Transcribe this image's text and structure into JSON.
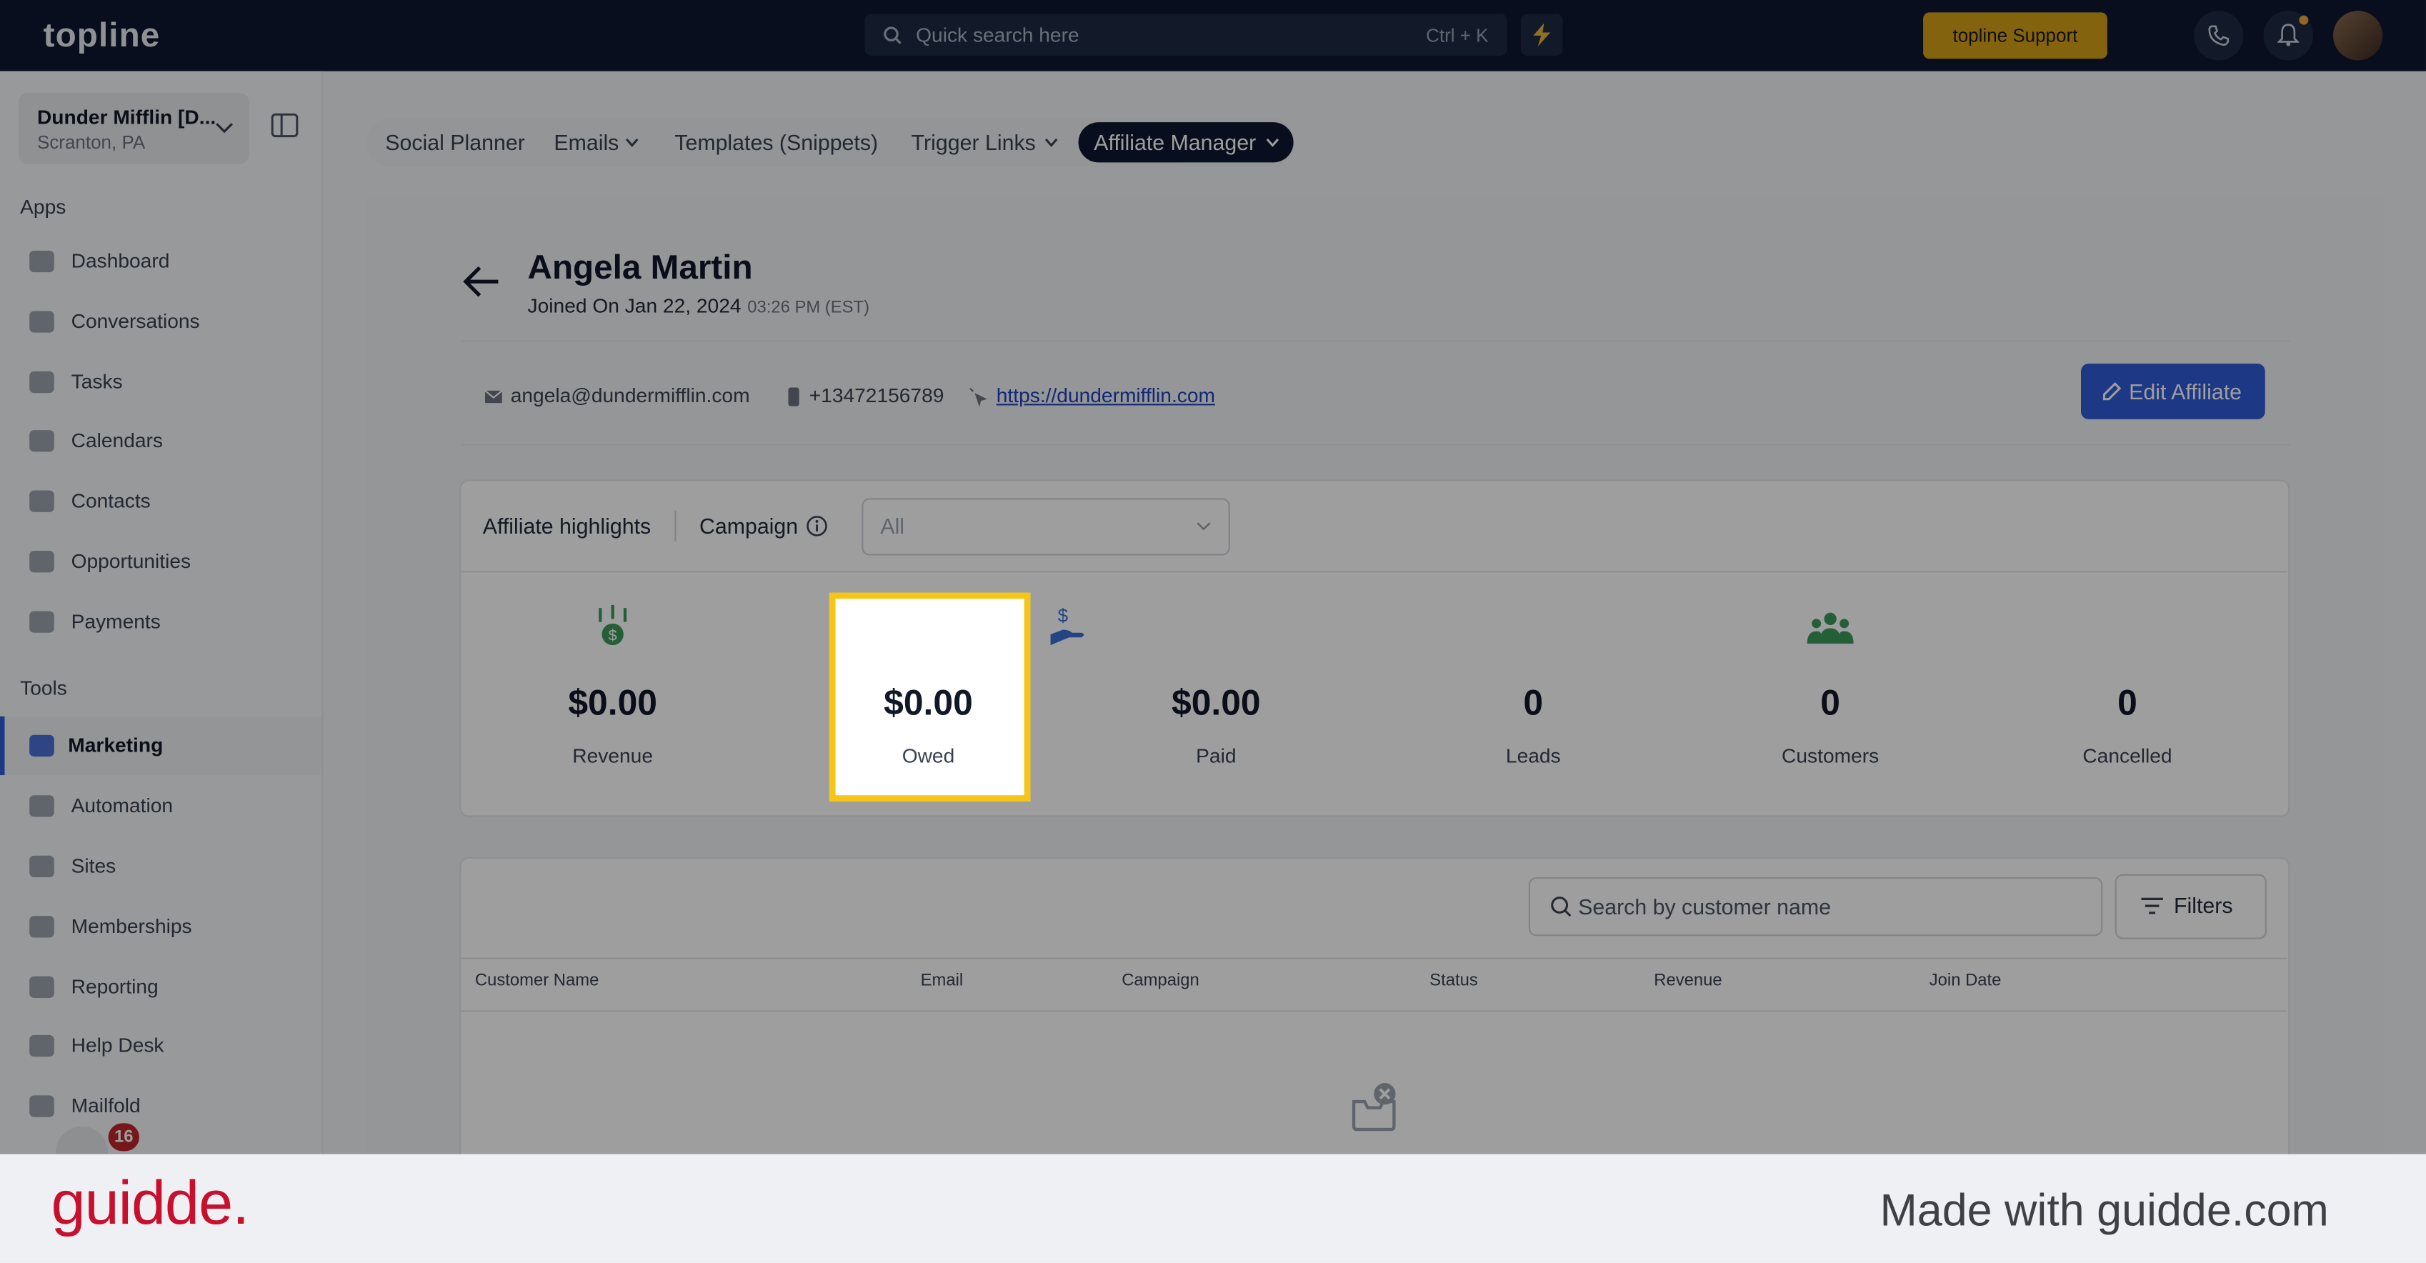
{
  "topbar": {
    "logo": "topline",
    "search_placeholder": "Quick search here",
    "shortcut": "Ctrl + K",
    "support_label": "topline Support"
  },
  "sidebar": {
    "account_name": "Dunder Mifflin [D...",
    "account_location": "Scranton, PA",
    "apps_heading": "Apps",
    "apps": [
      {
        "label": "Dashboard",
        "icon": "dashboard-icon"
      },
      {
        "label": "Conversations",
        "icon": "chat-icon"
      },
      {
        "label": "Tasks",
        "icon": "tasks-icon"
      },
      {
        "label": "Calendars",
        "icon": "calendar-icon"
      },
      {
        "label": "Contacts",
        "icon": "person-icon"
      },
      {
        "label": "Opportunities",
        "icon": "target-icon"
      },
      {
        "label": "Payments",
        "icon": "card-icon"
      }
    ],
    "tools_heading": "Tools",
    "tools": [
      {
        "label": "Marketing",
        "icon": "megaphone-icon"
      },
      {
        "label": "Automation",
        "icon": "gears-icon"
      },
      {
        "label": "Sites",
        "icon": "globe-icon"
      },
      {
        "label": "Memberships",
        "icon": "group-icon"
      },
      {
        "label": "Reporting",
        "icon": "pie-icon"
      },
      {
        "label": "Help Desk",
        "icon": "help-icon"
      },
      {
        "label": "Mailfold",
        "icon": "mail-icon"
      }
    ],
    "badge_count": "16"
  },
  "tabs": [
    {
      "label": "Social Planner"
    },
    {
      "label": "Emails"
    },
    {
      "label": "Templates (Snippets)"
    },
    {
      "label": "Trigger Links"
    },
    {
      "label": "Affiliate Manager"
    }
  ],
  "affiliate": {
    "name": "Angela Martin",
    "joined": "Joined On Jan 22, 2024",
    "joined_time": "03:26 PM (EST)",
    "email": "angela@dundermifflin.com",
    "phone": "+13472156789",
    "website": "https://dundermifflin.com",
    "edit_label": "Edit Affiliate"
  },
  "highlights": {
    "title": "Affiliate highlights",
    "campaign_label": "Campaign",
    "campaign_value": "All",
    "stats": [
      {
        "value": "$0.00",
        "label": "Revenue"
      },
      {
        "value": "$0.00",
        "label": "Owed"
      },
      {
        "value": "$0.00",
        "label": "Paid"
      },
      {
        "value": "0",
        "label": "Leads"
      },
      {
        "value": "0",
        "label": "Customers"
      },
      {
        "value": "0",
        "label": "Cancelled"
      }
    ]
  },
  "table": {
    "search_placeholder": "Search by customer name",
    "filters_label": "Filters",
    "columns": [
      "Customer Name",
      "Email",
      "Campaign",
      "Status",
      "Revenue",
      "Join Date"
    ]
  },
  "footer": {
    "brand": "guidde.",
    "made_with": "Made with guidde.com"
  },
  "colors": {
    "accent": "#2f5bd6",
    "highlight": "#f5c518",
    "brand": "#c8102e",
    "topbar": "#0d1730"
  }
}
